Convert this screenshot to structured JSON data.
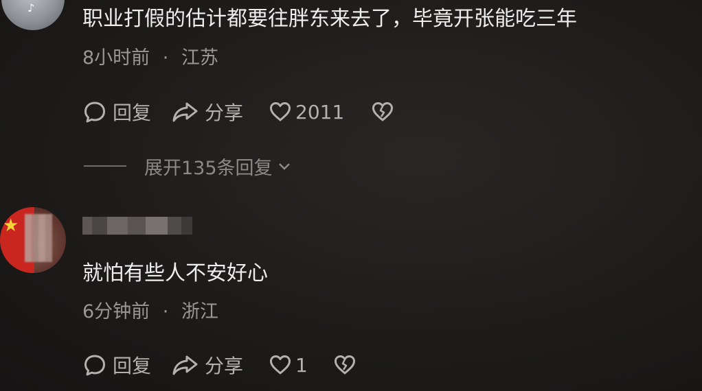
{
  "comments": [
    {
      "text": "职业打假的估计都要往胖东来去了，毕竟开张能吃三年",
      "time": "8小时前",
      "location": "江苏",
      "reply_label": "回复",
      "share_label": "分享",
      "like_count": "2011",
      "expand_replies_label": "展开135条回复"
    },
    {
      "text": "就怕有些人不安好心",
      "time": "6分钟前",
      "location": "浙江",
      "reply_label": "回复",
      "share_label": "分享",
      "like_count": "1"
    }
  ],
  "separator": "·",
  "icons": {
    "reply": "comment-bubble-icon",
    "share": "share-arrow-icon",
    "like": "heart-icon",
    "dislike": "broken-heart-icon",
    "expand": "chevron-down-icon",
    "app_badge": "tiktok-icon"
  },
  "colors": {
    "background": "#1c1a1a",
    "text_primary": "#eeeeee",
    "text_secondary": "#9a9796",
    "icon": "#b4b1b0"
  }
}
